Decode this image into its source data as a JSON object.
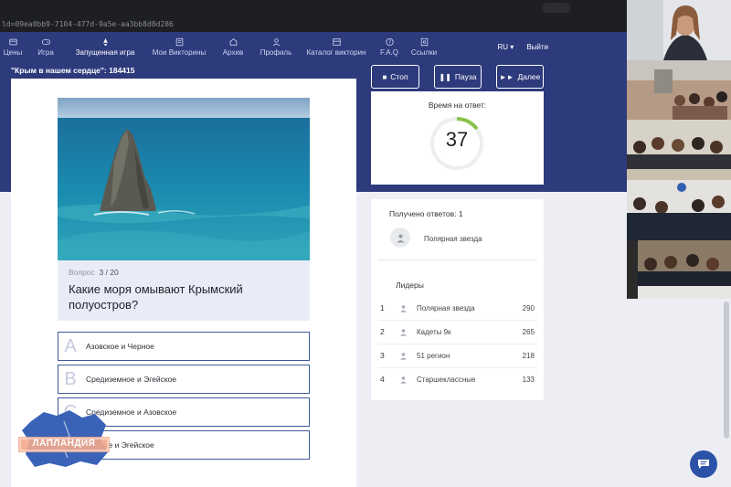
{
  "browser": {
    "url": "ld=09ea0bb9-7104-477d-9a5e-aa3bb8d8d286"
  },
  "nav": {
    "items": [
      {
        "label": "Цены",
        "icon": "tag-icon"
      },
      {
        "label": "Игра",
        "icon": "gamepad-icon"
      },
      {
        "label": "Запущенная игра",
        "icon": "rocket-icon",
        "active": true
      },
      {
        "label": "Мои Викторины",
        "icon": "quiz-list-icon"
      },
      {
        "label": "Архив",
        "icon": "archive-icon"
      },
      {
        "label": "Профиль",
        "icon": "user-icon"
      },
      {
        "label": "Каталог викторин",
        "icon": "catalog-icon"
      },
      {
        "label": "F.A.Q",
        "icon": "help-icon"
      },
      {
        "label": "Ссылки",
        "icon": "link-icon"
      }
    ],
    "language": "RU",
    "logout": "Выйти"
  },
  "game": {
    "title": "\"Крым в нашем сердце\": 184415"
  },
  "controls": {
    "stop": "Стоп",
    "pause": "Пауза",
    "next": "Далее"
  },
  "question": {
    "number_label": "Вопрос",
    "number": "3 / 20",
    "text": "Какие моря омывают Крымский полуостров?",
    "answers": [
      {
        "letter": "A",
        "text": "Азовское и Черное"
      },
      {
        "letter": "B",
        "text": "Средиземное и Эгейское"
      },
      {
        "letter": "C",
        "text": "Средиземное и Азовское"
      },
      {
        "letter": "D",
        "text": "Черное и Эгейское"
      }
    ]
  },
  "timer": {
    "label": "Время на ответ:",
    "seconds": "37",
    "fraction_remaining": 0.15
  },
  "results": {
    "answers_received": "Получено ответов: 1",
    "respondent": "Полярная звезда",
    "leaders_title": "Лидеры",
    "leaders": [
      {
        "rank": "1",
        "name": "Полярная звезда",
        "score": "290"
      },
      {
        "rank": "2",
        "name": "Кадеты 9к",
        "score": "265"
      },
      {
        "rank": "3",
        "name": "51 регион",
        "score": "218"
      },
      {
        "rank": "4",
        "name": "Старшеклассные",
        "score": "133"
      }
    ]
  },
  "logo": {
    "text": "ЛАПЛАНДИЯ"
  },
  "colors": {
    "nav_bg": "#2d3a7c",
    "accent": "#3c5a9a",
    "timer_green": "#8bc34a",
    "chat_button": "#2b52a6"
  }
}
